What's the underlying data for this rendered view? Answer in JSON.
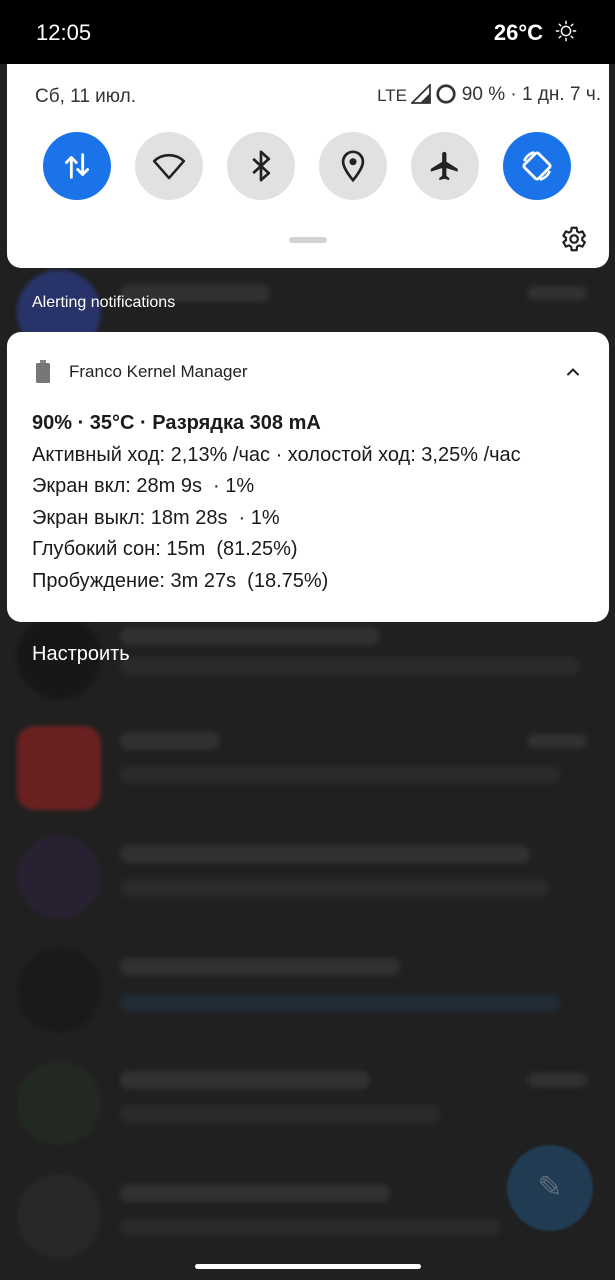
{
  "status_bar": {
    "time": "12:05",
    "temperature": "26°C",
    "weather_icon": "sun-icon"
  },
  "quick_settings": {
    "date": "Сб, 11 июл.",
    "network": "LTE",
    "battery_info": "90 % · 1 дн. 7 ч.",
    "tiles": [
      {
        "icon": "mobile-data-icon",
        "active": true
      },
      {
        "icon": "wifi-icon",
        "active": false
      },
      {
        "icon": "bluetooth-icon",
        "active": false
      },
      {
        "icon": "location-icon",
        "active": false
      },
      {
        "icon": "airplane-mode-icon",
        "active": false
      },
      {
        "icon": "auto-rotate-icon",
        "active": true
      }
    ],
    "accent_color": "#1a73e8"
  },
  "notifications": {
    "section_label": "Alerting notifications",
    "card": {
      "app_name": "Franco Kernel Manager",
      "title": "90% · 35°C · Разрядка 308 mA",
      "lines": [
        "Активный ход: 2,13% /час · холостой ход: 3,25% /час",
        "Экран вкл: 28m 9s  · 1%",
        "Экран выкл: 18m 28s  · 1%",
        "Глубокий сон: 15m  (81.25%)",
        "Пробуждение: 3m 27s  (18.75%)"
      ]
    },
    "customize_label": "Настроить"
  }
}
